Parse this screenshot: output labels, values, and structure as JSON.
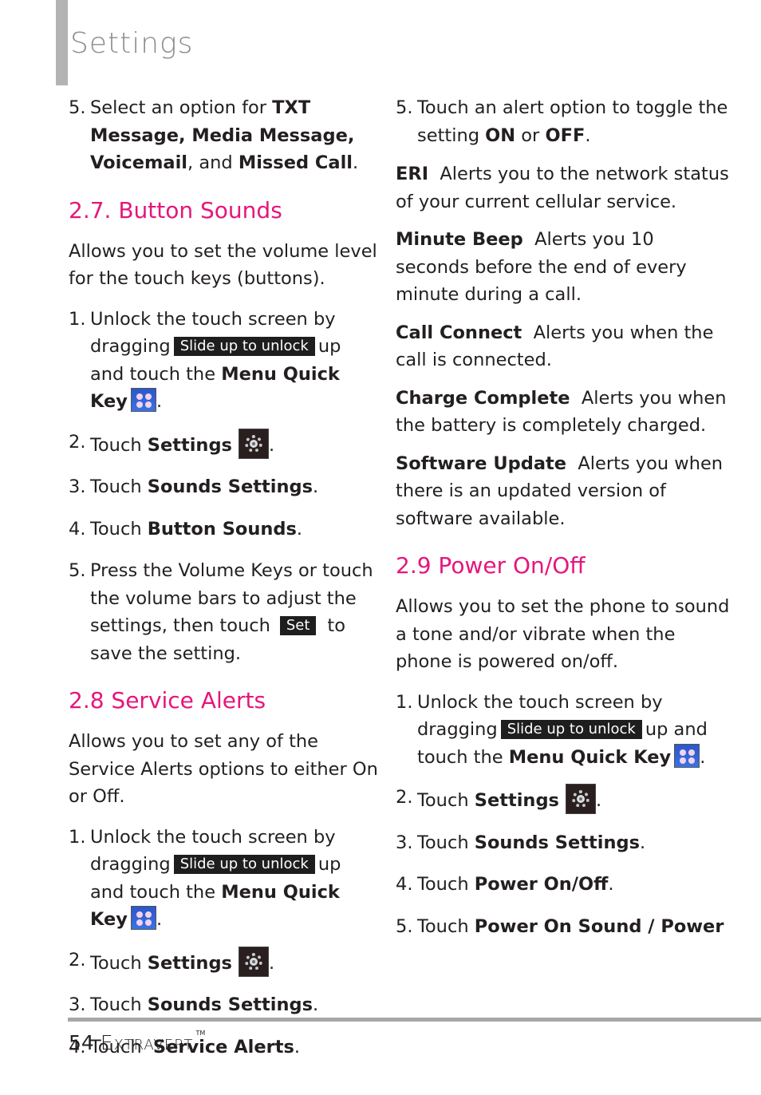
{
  "header": {
    "title": "Settings"
  },
  "left": {
    "intro_step": {
      "num": "5.",
      "pre": "Select an option for ",
      "b1": "TXT Message, Media Message, Voicemail",
      "mid": ", and ",
      "b2": "Missed Call",
      "post": "."
    },
    "button_sounds": {
      "heading": "2.7. Button Sounds",
      "desc": "Allows you to set the volume level for the touch keys (buttons).",
      "steps": [
        {
          "num": "1.",
          "a": "Unlock the touch screen by dragging",
          "badge": "Slide up to unlock",
          "b": "up and touch the",
          "bold": "Menu Quick Key",
          "end": "."
        },
        {
          "num": "2.",
          "a": "Touch ",
          "bold": "Settings",
          "end": "."
        },
        {
          "num": "3.",
          "a": "Touch ",
          "bold": "Sounds Settings",
          "end": "."
        },
        {
          "num": "4.",
          "a": "Touch ",
          "bold": "Button Sounds",
          "end": "."
        },
        {
          "num": "5.",
          "a": "Press the Volume Keys or touch the volume bars to adjust the settings, then touch",
          "badge": "Set",
          "b": "to save the setting."
        }
      ]
    },
    "service_alerts": {
      "heading": "2.8 Service Alerts",
      "desc": "Allows you to set any of the Service Alerts options to either On or Off.",
      "steps": [
        {
          "num": "1.",
          "a": "Unlock the touch screen by dragging",
          "badge": "Slide up to unlock",
          "b": "up and touch the",
          "bold": "Menu Quick Key",
          "end": "."
        },
        {
          "num": "2.",
          "a": "Touch ",
          "bold": "Settings",
          "end": "."
        },
        {
          "num": "3.",
          "a": "Touch ",
          "bold": "Sounds Settings",
          "end": "."
        },
        {
          "num": "4.",
          "a": "Touch  ",
          "bold": "Service Alerts",
          "end": "."
        }
      ]
    }
  },
  "right": {
    "step5": {
      "num": "5.",
      "a": "Touch an alert option to toggle the setting ",
      "on": "ON",
      "or": " or ",
      "off": "OFF",
      "end": "."
    },
    "alerts": [
      {
        "term": "ERI",
        "desc": "Alerts you to the network status of your current cellular service."
      },
      {
        "term": "Minute Beep",
        "desc": "Alerts you 10 seconds before the end of every minute during a call."
      },
      {
        "term": "Call Connect",
        "desc": "Alerts you when the call is connected."
      },
      {
        "term": "Charge Complete",
        "desc": "Alerts you when the battery is completely charged."
      },
      {
        "term": "Software Update",
        "desc": "Alerts you when there is an updated version of software available."
      }
    ],
    "power": {
      "heading": "2.9 Power On/Off",
      "desc": "Allows you to set the phone to sound a tone and/or vibrate when the phone is powered on/off.",
      "steps": [
        {
          "num": "1.",
          "a": "Unlock the touch screen by dragging",
          "badge": "Slide up to unlock",
          "b": "up and touch the",
          "bold": "Menu Quick Key",
          "end": "."
        },
        {
          "num": "2.",
          "a": "Touch ",
          "bold": "Settings",
          "end": "."
        },
        {
          "num": "3.",
          "a": "Touch ",
          "bold": "Sounds Settings",
          "end": "."
        },
        {
          "num": "4.",
          "a": "Touch ",
          "bold": "Power On/Off",
          "end": "."
        },
        {
          "num": "5.",
          "a": "Touch ",
          "bold": "Power On Sound / Power",
          "end": ""
        }
      ]
    }
  },
  "footer": {
    "page_number": "54",
    "brand": "Extravert",
    "tm": "TM"
  }
}
